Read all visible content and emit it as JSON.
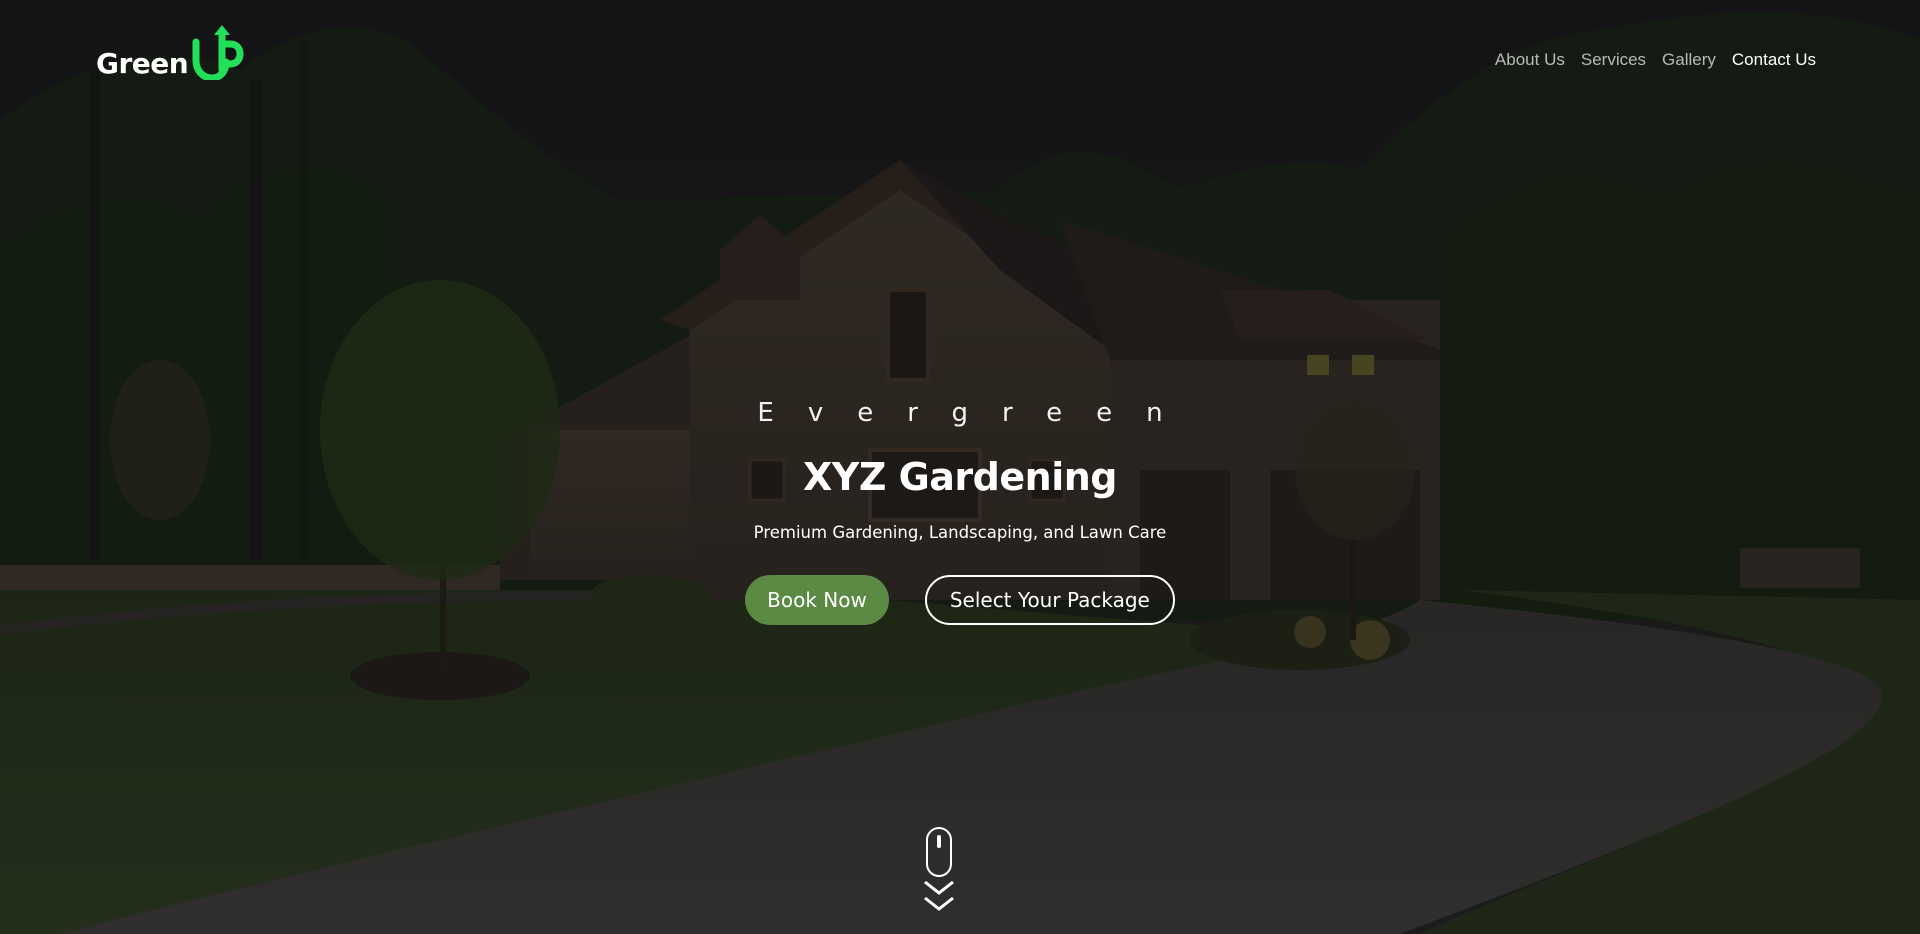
{
  "header": {
    "logo_text": "Green",
    "logo_mark": "UP",
    "logo_mark_color": "#22e05a",
    "nav": [
      {
        "label": "About Us"
      },
      {
        "label": "Services"
      },
      {
        "label": "Gallery"
      },
      {
        "label": "Contact Us"
      }
    ]
  },
  "hero": {
    "eyebrow": "Evergreen",
    "title": "XYZ Gardening",
    "subtitle": "Premium Gardening, Landscaping, and Lawn Care",
    "primary_button": "Book Now",
    "secondary_button": "Select Your Package",
    "primary_color": "#5a8a43",
    "scroll_icon": "mouse-scroll-icon"
  }
}
